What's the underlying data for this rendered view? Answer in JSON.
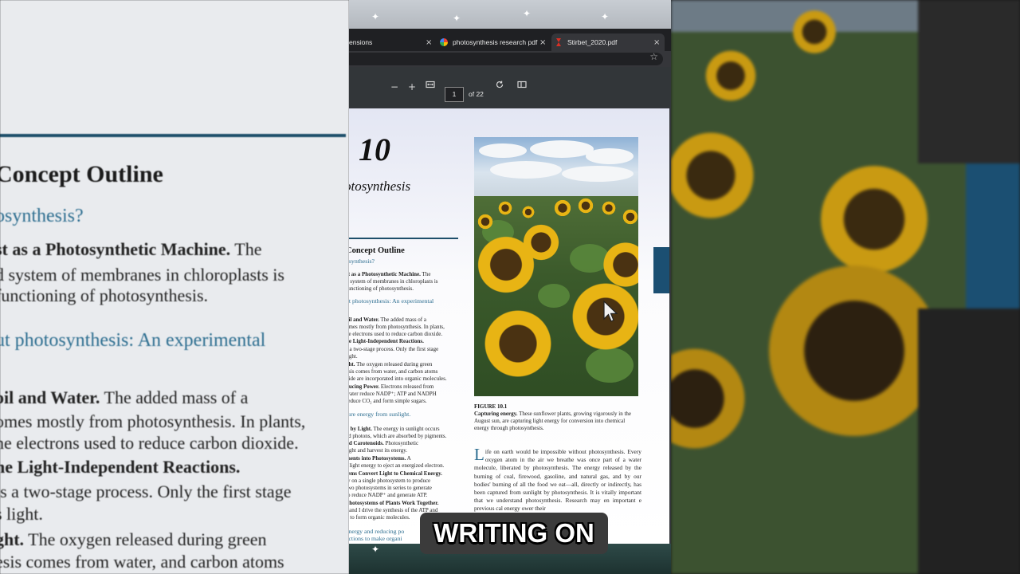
{
  "browser": {
    "tabs": [
      {
        "label": "ensions",
        "close": "×"
      },
      {
        "label": "photosynthesis research pdf",
        "close": "×"
      },
      {
        "label": "Stirbet_2020.pdf",
        "close": "×"
      }
    ],
    "bookmark_icon": "☆"
  },
  "pdf_toolbar": {
    "zoom_out": "−",
    "zoom_in": "+",
    "page_number": "1",
    "page_count": "of 22"
  },
  "page": {
    "chapter_number": "10",
    "chapter_title": "otosynthesis",
    "outline_heading": "Concept Outline",
    "outline_lines": [
      {
        "text": "osynthesis?",
        "style": "blue"
      },
      {
        "bold": "st as a Photosynthetic Machine.",
        "text": "  The"
      },
      {
        "text": "d system of membranes in chloroplasts is"
      },
      {
        "text": "functioning of photosynthesis."
      },
      {
        "text": "ut photosynthesis: An experimental",
        "style": "blue"
      },
      {
        "bold": "oil and Water.",
        "text": "  The added mass of a"
      },
      {
        "text": "omes mostly from photosynthesis. In plants,"
      },
      {
        "text": "he electrons used to reduce carbon dioxide."
      },
      {
        "bold": "he Light-Independent Reactions.",
        "text": ""
      },
      {
        "text": "s a two-stage process. Only the first stage"
      },
      {
        "text": "light."
      },
      {
        "bold": "ght.",
        "text": "  The oxygen released during green"
      },
      {
        "text": "esis comes from water, and carbon atoms"
      },
      {
        "text": "xide are incorporated into organic molecules."
      },
      {
        "bold": "ducing Power.",
        "text": "  Electrons released from"
      },
      {
        "text": "water reduce NADP⁺; ATP and NADPH"
      },
      {
        "text": "reduce CO₂ and form simple sugars."
      },
      {
        "text": "ture energy from sunlight.",
        "style": "blue"
      },
      {
        "bold": "d by Light.",
        "text": "  The energy in sunlight occurs"
      },
      {
        "text": "ed photons, which are absorbed by pigments."
      },
      {
        "bold": "nd Carotenoids.",
        "text": "  Photosynthetic"
      },
      {
        "text": "light and harvest its energy."
      },
      {
        "bold": "ments into Photosystems.",
        "text": "  A"
      },
      {
        "text": "s light energy to eject an energized electron."
      },
      {
        "bold": "tems Convert Light to Chemical Energy.",
        "text": ""
      },
      {
        "text": "ly on a single photosystem to produce"
      },
      {
        "text": "two photosystems in series to generate"
      },
      {
        "text": "to reduce NADP⁺ and generate ATP."
      },
      {
        "bold": "Photosystems of Plants Work Together.",
        "text": ""
      },
      {
        "text": "I and I drive the synthesis of the ATP and"
      },
      {
        "text": "d to form organic molecules."
      },
      {
        "text": "energy and reducing po",
        "style": "blue"
      },
      {
        "text": "actions to make organi",
        "style": "blue"
      }
    ],
    "figure_label": "FIGURE 10.1",
    "figure_caption_bold": "Capturing energy.",
    "figure_caption": " These sunflower plants, growing vigorously in the August sun, are capturing light energy for conversion into chemical energy through photosynthesis.",
    "body_dropcap": "L",
    "body_text": "ife on earth would be impossible without photosynthesis. Every oxygen atom in the air we breathe was once part of a water molecule, liberated by photosynthesis. The energy released by the burning of coal, firewood, gasoline, and natural gas, and by our bodies' burning of all the food we eat—all, directly or indirectly, has been captured from sunlight by photosynthesis. It is vitally important that we understand photosynthesis. Research may en important e previous cal energy ower their"
  },
  "left_zoom": {
    "heading": "Concept Outline",
    "lines": [
      {
        "text": "osynthesis?",
        "style": "blue"
      },
      {
        "bold": "st as a Photosynthetic Machine.",
        "text": "   The"
      },
      {
        "text": "d system of membranes in chloroplasts is"
      },
      {
        "text": "functioning of photosynthesis."
      },
      {
        "text": "ut photosynthesis: An experimental",
        "style": "blue"
      },
      {
        "bold": "oil and Water.",
        "text": "   The added mass of a"
      },
      {
        "text": "omes mostly from photosynthesis. In plants,"
      },
      {
        "text": "he electrons used to reduce carbon dioxide."
      },
      {
        "bold": "he Light-Independent Reactions.",
        "text": ""
      },
      {
        "text": "is a two-stage process. Only the first stage"
      },
      {
        "text": "s light."
      },
      {
        "bold": "ght.",
        "text": "   The oxygen released during green"
      },
      {
        "text": "esis comes from water, and carbon atoms"
      }
    ]
  },
  "caption_overlay": "WRITING ON",
  "colors": {
    "outline_blue": "#2d6e90",
    "rule": "#1e4f6b",
    "toolbar": "#323639",
    "tabbar": "#1f2023"
  }
}
